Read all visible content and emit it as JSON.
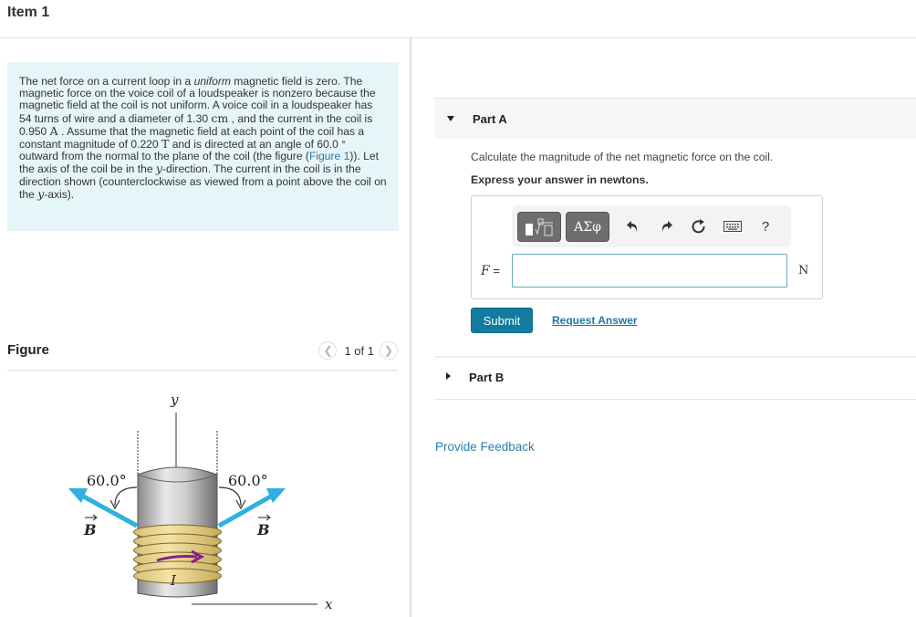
{
  "header": {
    "title": "Item 1"
  },
  "problem": {
    "segments": [
      {
        "t": "The net force on a current loop in a "
      },
      {
        "t": "uniform",
        "style": "em"
      },
      {
        "t": " magnetic field is zero. The magnetic force on the voice coil of a loudspeaker is nonzero because the magnetic field at the coil is not uniform. A voice coil in a loudspeaker has 54 turns of wire and a diameter of 1.30 "
      },
      {
        "t": "cm",
        "style": "math"
      },
      {
        "t": " , and the current in the coil is 0.950 "
      },
      {
        "t": "A",
        "style": "math"
      },
      {
        "t": " . Assume that the magnetic field at each point of the coil has a constant magnitude of 0.220 "
      },
      {
        "t": "T",
        "style": "math"
      },
      {
        "t": " and is directed at an angle of 60.0 ° outward from the normal to the plane of the coil (the figure ("
      },
      {
        "t": "Figure 1",
        "style": "link"
      },
      {
        "t": ")). Let the axis of the coil be in the "
      },
      {
        "t": "y",
        "style": "mathi"
      },
      {
        "t": "-direction. The current in the coil is in the direction shown (counterclockwise as viewed from a point above the coil on the "
      },
      {
        "t": "y",
        "style": "mathi"
      },
      {
        "t": "-axis)."
      }
    ]
  },
  "figure": {
    "title": "Figure",
    "pager": "1 of 1",
    "prev_icon": "chevron-left-icon",
    "next_icon": "chevron-right-icon",
    "labels": {
      "y_axis": "y",
      "x_axis": "x",
      "angle_left": "60.0°",
      "angle_right": "60.0°",
      "field_left": "B",
      "field_right": "B",
      "current": "I"
    }
  },
  "part_a": {
    "label": "Part A",
    "question": "Calculate the magnitude of the net magnetic force on the coil.",
    "instruction": "Express your answer in newtons.",
    "toolbar": {
      "templates_icon": "templates-icon",
      "symbols_label": "ΑΣφ",
      "undo_icon": "undo-icon",
      "redo_icon": "redo-icon",
      "reset_icon": "reset-icon",
      "keyboard_icon": "keyboard-icon",
      "help_label": "?"
    },
    "variable": "F",
    "equals": " =",
    "answer_value": "",
    "unit": "N",
    "submit_label": "Submit",
    "request_label": "Request Answer"
  },
  "part_b": {
    "label": "Part B"
  },
  "feedback_label": "Provide Feedback"
}
